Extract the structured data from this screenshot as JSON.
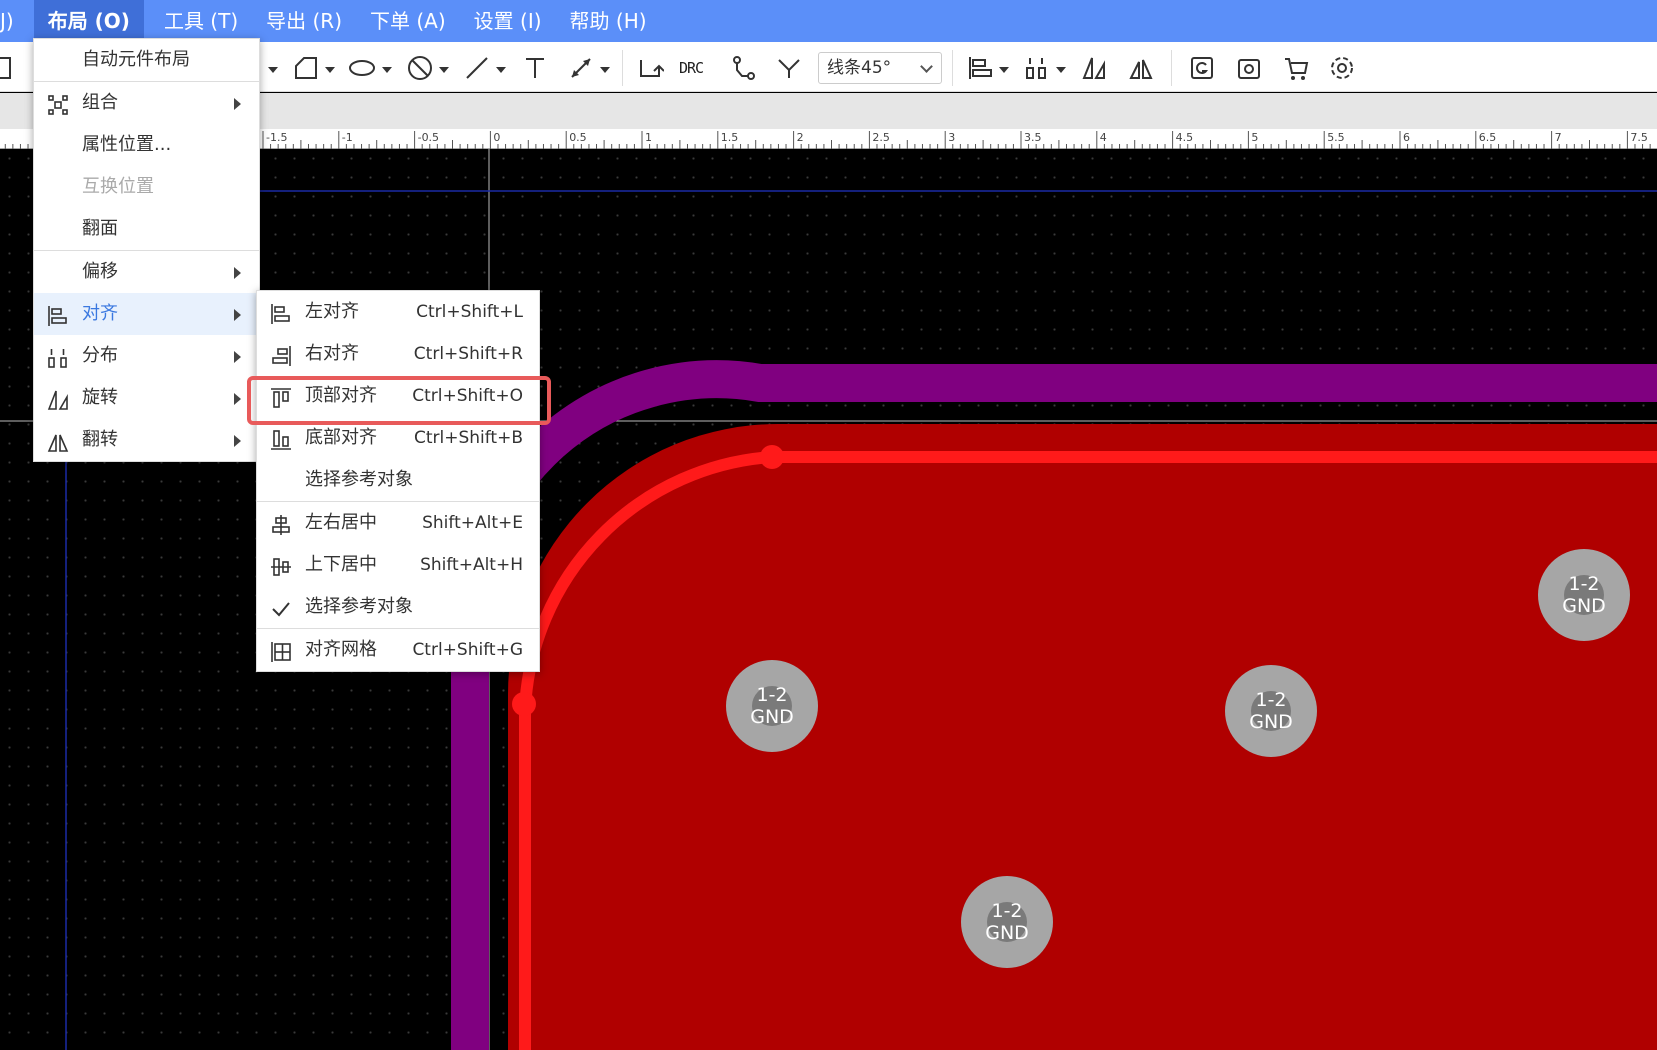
{
  "menubar": {
    "items": [
      {
        "label": "J)",
        "active": false
      },
      {
        "label": "布局 (O)",
        "active": true
      },
      {
        "label": "工具 (T)",
        "active": false
      },
      {
        "label": "导出 (R)",
        "active": false
      },
      {
        "label": "下单 (A)",
        "active": false
      },
      {
        "label": "设置 (I)",
        "active": false
      },
      {
        "label": "帮助 (H)",
        "active": false
      }
    ]
  },
  "toolbar": {
    "drc_label": "DRC",
    "line_mode": "线条45°"
  },
  "ruler": {
    "ticks": [
      "-1.5",
      "-1",
      "-0.5",
      "0",
      "0.5",
      "1",
      "1.5",
      "2",
      "2.5",
      "3",
      "3.5",
      "4",
      "4.5",
      "5",
      "5.5",
      "6",
      "6.5",
      "7",
      "7.5"
    ]
  },
  "layout_menu": {
    "items": [
      {
        "label": "自动元件布局",
        "icon": "",
        "has_submenu": false,
        "disabled": false
      },
      {
        "label": "组合",
        "icon": "group-icon",
        "has_submenu": true,
        "disabled": false
      },
      {
        "label": "属性位置...",
        "icon": "",
        "has_submenu": false,
        "disabled": false
      },
      {
        "label": "互换位置",
        "icon": "",
        "has_submenu": false,
        "disabled": true
      },
      {
        "label": "翻面",
        "icon": "",
        "has_submenu": false,
        "disabled": false
      },
      {
        "label": "偏移",
        "icon": "",
        "has_submenu": true,
        "disabled": false
      },
      {
        "label": "对齐",
        "icon": "align-left-icon",
        "has_submenu": true,
        "disabled": false
      },
      {
        "label": "分布",
        "icon": "distribute-icon",
        "has_submenu": true,
        "disabled": false
      },
      {
        "label": "旋转",
        "icon": "rotate-icon",
        "has_submenu": true,
        "disabled": false
      },
      {
        "label": "翻转",
        "icon": "flip-icon",
        "has_submenu": true,
        "disabled": false
      }
    ]
  },
  "align_menu": {
    "items": [
      {
        "label": "左对齐",
        "shortcut": "Ctrl+Shift+L",
        "icon": "align-left-icon"
      },
      {
        "label": "右对齐",
        "shortcut": "Ctrl+Shift+R",
        "icon": "align-right-icon"
      },
      {
        "label": "顶部对齐",
        "shortcut": "Ctrl+Shift+O",
        "icon": "align-top-icon"
      },
      {
        "label": "底部对齐",
        "shortcut": "Ctrl+Shift+B",
        "icon": "align-bottom-icon"
      },
      {
        "label": "选择参考对象",
        "shortcut": "",
        "icon": ""
      },
      {
        "label": "左右居中",
        "shortcut": "Shift+Alt+E",
        "icon": "align-center-h-icon"
      },
      {
        "label": "上下居中",
        "shortcut": "Shift+Alt+H",
        "icon": "align-center-v-icon"
      },
      {
        "label": "选择参考对象",
        "shortcut": "",
        "icon": "check-icon"
      },
      {
        "label": "对齐网格",
        "shortcut": "Ctrl+Shift+G",
        "icon": "grid-align-icon"
      }
    ]
  },
  "pads": [
    {
      "number": "1-2",
      "net": "GND"
    },
    {
      "number": "1-2",
      "net": "GND"
    },
    {
      "number": "1-2",
      "net": "GND"
    },
    {
      "number": "1-2",
      "net": "GND"
    }
  ],
  "colors": {
    "menubar": "#5b8ff9",
    "board_fill": "#b00000",
    "outline_purple": "#800080",
    "trace_red": "#ff0000",
    "highlight_border": "#e85a5a",
    "pad": "#a6a6a6"
  }
}
